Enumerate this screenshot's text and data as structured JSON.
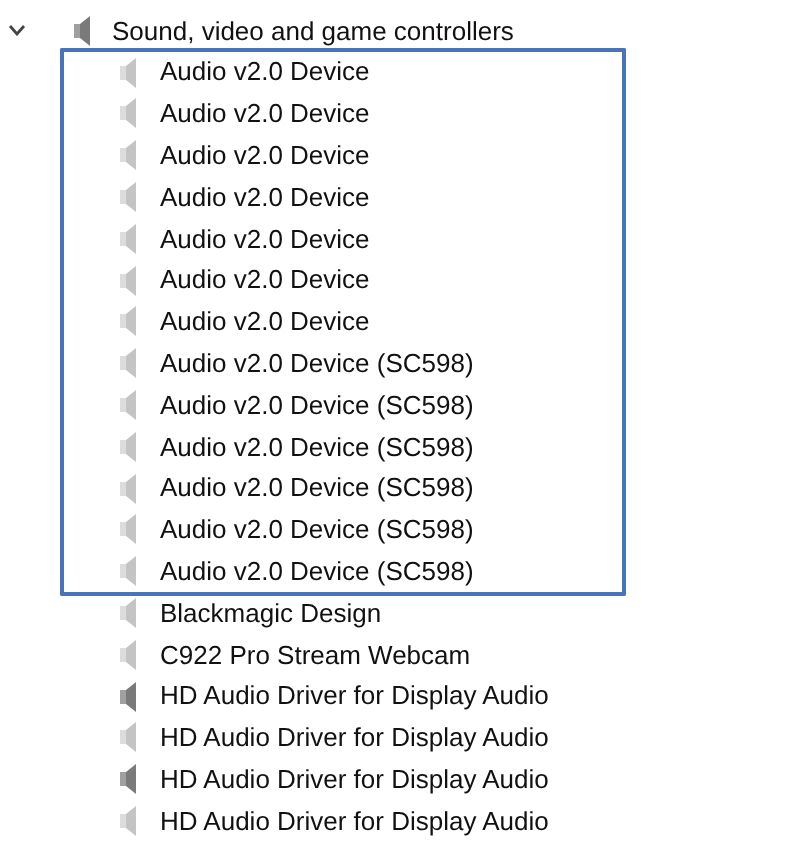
{
  "category": {
    "label": "Sound, video and game controllers",
    "expanded": true,
    "children": [
      {
        "label": "Audio v2.0 Device",
        "disabled": true,
        "highlighted": true
      },
      {
        "label": "Audio v2.0 Device",
        "disabled": true,
        "highlighted": true
      },
      {
        "label": "Audio v2.0 Device",
        "disabled": true,
        "highlighted": true
      },
      {
        "label": "Audio v2.0 Device",
        "disabled": true,
        "highlighted": true
      },
      {
        "label": "Audio v2.0 Device",
        "disabled": true,
        "highlighted": true
      },
      {
        "label": "Audio v2.0 Device",
        "disabled": true,
        "highlighted": true
      },
      {
        "label": "Audio v2.0 Device",
        "disabled": true,
        "highlighted": true
      },
      {
        "label": "Audio v2.0 Device (SC598)",
        "disabled": true,
        "highlighted": true
      },
      {
        "label": "Audio v2.0 Device (SC598)",
        "disabled": true,
        "highlighted": true
      },
      {
        "label": "Audio v2.0 Device (SC598)",
        "disabled": true,
        "highlighted": true
      },
      {
        "label": "Audio v2.0 Device (SC598)",
        "disabled": true,
        "highlighted": true
      },
      {
        "label": "Audio v2.0 Device (SC598)",
        "disabled": true,
        "highlighted": true
      },
      {
        "label": "Audio v2.0 Device (SC598)",
        "disabled": true,
        "highlighted": true
      },
      {
        "label": "Blackmagic Design",
        "disabled": true,
        "highlighted": false
      },
      {
        "label": "C922 Pro Stream Webcam",
        "disabled": true,
        "highlighted": false
      },
      {
        "label": "HD Audio Driver for Display Audio",
        "disabled": false,
        "highlighted": false
      },
      {
        "label": "HD Audio Driver for Display Audio",
        "disabled": true,
        "highlighted": false
      },
      {
        "label": "HD Audio Driver for Display Audio",
        "disabled": false,
        "highlighted": false
      },
      {
        "label": "HD Audio Driver for Display Audio",
        "disabled": true,
        "highlighted": false
      }
    ]
  }
}
